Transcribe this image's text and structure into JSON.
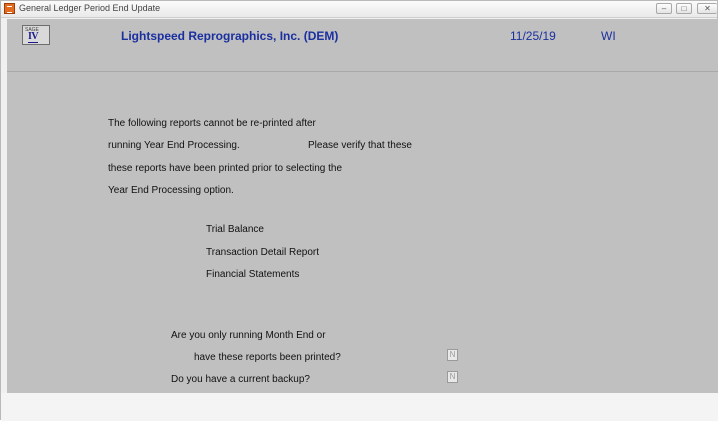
{
  "window": {
    "title": "General Ledger Period End Update",
    "min_glyph": "–",
    "max_glyph": "□",
    "close_glyph": "✕"
  },
  "header": {
    "logo_top": "SAGE",
    "logo_numeral": "IV",
    "company": "Lightspeed Reprographics, Inc. (DEM)",
    "date": "11/25/19",
    "user": "WI"
  },
  "message": {
    "line1": "The following reports cannot be re-printed after",
    "line2a": "running Year End Processing.",
    "line2b": "Please verify that these",
    "line3": "these reports have been printed prior to selecting the",
    "line4": "Year End Processing option."
  },
  "reports": [
    "Trial Balance",
    "Transaction Detail Report",
    "Financial Statements"
  ],
  "questions": {
    "q1_line1": "Are you only running Month End or",
    "q1_line2": "have these reports been printed?",
    "q1_value": "N",
    "q2": "Do you have a current backup?",
    "q2_value": "N"
  }
}
